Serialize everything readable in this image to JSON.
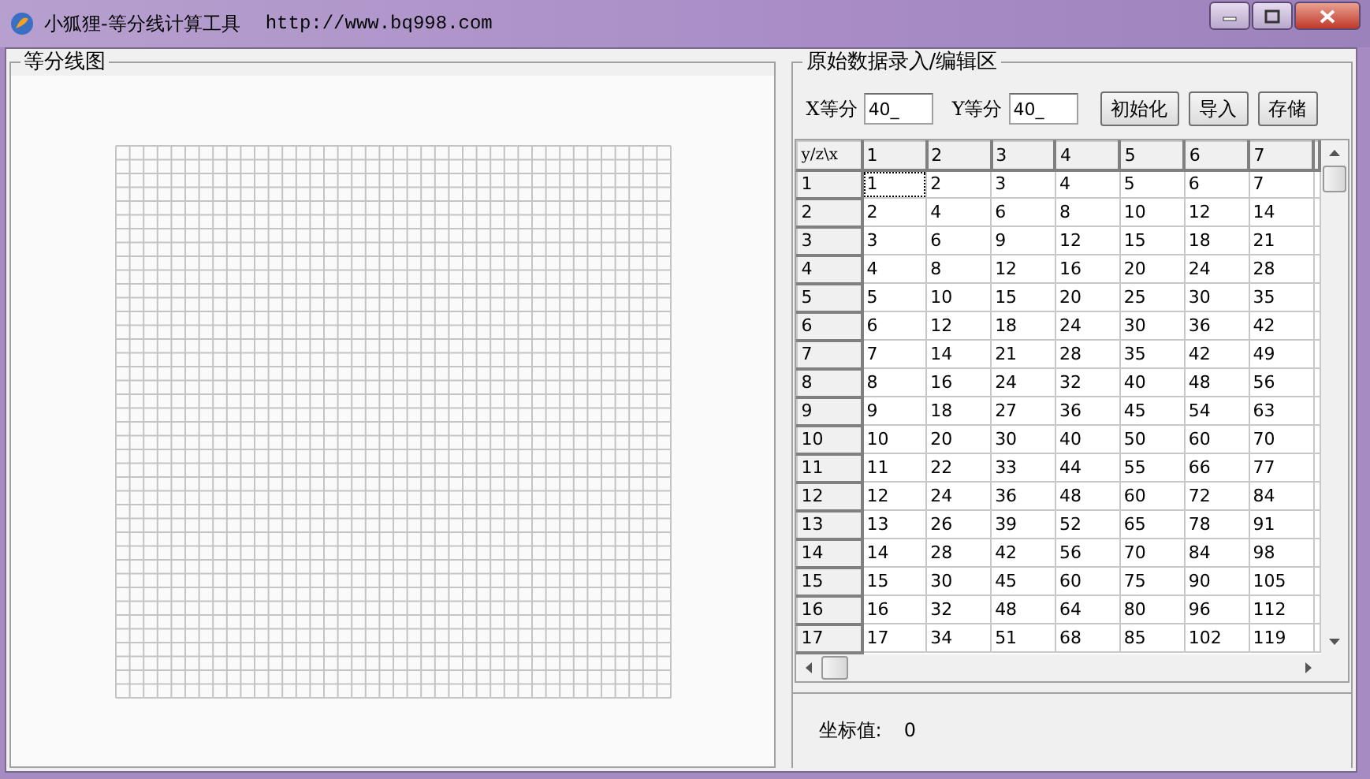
{
  "window": {
    "title": "小狐狸-等分线计算工具",
    "url": "http://www.bq998.com"
  },
  "graph_panel": {
    "title": "等分线图"
  },
  "editor_panel": {
    "title": "原始数据录入/编辑区",
    "fields": [
      {
        "label": "X等分",
        "value": "40_"
      },
      {
        "label": "Y等分",
        "value": "40_"
      }
    ],
    "buttons": [
      "初始化",
      "导入",
      "存储"
    ],
    "table": {
      "corner": "y/z\\x",
      "columns": [
        "1",
        "2",
        "3",
        "4",
        "5",
        "6",
        "7"
      ],
      "rows": [
        {
          "header": "1",
          "cells": [
            {
              "text": "1",
              "selected": true
            },
            {
              "text": "2",
              "selected": false
            },
            {
              "text": "3",
              "selected": false
            },
            {
              "text": "4",
              "selected": false
            },
            {
              "text": "5",
              "selected": false
            },
            {
              "text": "6",
              "selected": false
            },
            {
              "text": "7",
              "selected": false
            }
          ]
        },
        {
          "header": "2",
          "cells": [
            {
              "text": "2",
              "selected": false
            },
            {
              "text": "4",
              "selected": false
            },
            {
              "text": "6",
              "selected": false
            },
            {
              "text": "8",
              "selected": false
            },
            {
              "text": "10",
              "selected": false
            },
            {
              "text": "12",
              "selected": false
            },
            {
              "text": "14",
              "selected": false
            }
          ]
        },
        {
          "header": "3",
          "cells": [
            {
              "text": "3",
              "selected": false
            },
            {
              "text": "6",
              "selected": false
            },
            {
              "text": "9",
              "selected": false
            },
            {
              "text": "12",
              "selected": false
            },
            {
              "text": "15",
              "selected": false
            },
            {
              "text": "18",
              "selected": false
            },
            {
              "text": "21",
              "selected": false
            }
          ]
        },
        {
          "header": "4",
          "cells": [
            {
              "text": "4",
              "selected": false
            },
            {
              "text": "8",
              "selected": false
            },
            {
              "text": "12",
              "selected": false
            },
            {
              "text": "16",
              "selected": false
            },
            {
              "text": "20",
              "selected": false
            },
            {
              "text": "24",
              "selected": false
            },
            {
              "text": "28",
              "selected": false
            }
          ]
        },
        {
          "header": "5",
          "cells": [
            {
              "text": "5",
              "selected": false
            },
            {
              "text": "10",
              "selected": false
            },
            {
              "text": "15",
              "selected": false
            },
            {
              "text": "20",
              "selected": false
            },
            {
              "text": "25",
              "selected": false
            },
            {
              "text": "30",
              "selected": false
            },
            {
              "text": "35",
              "selected": false
            }
          ]
        },
        {
          "header": "6",
          "cells": [
            {
              "text": "6",
              "selected": false
            },
            {
              "text": "12",
              "selected": false
            },
            {
              "text": "18",
              "selected": false
            },
            {
              "text": "24",
              "selected": false
            },
            {
              "text": "30",
              "selected": false
            },
            {
              "text": "36",
              "selected": false
            },
            {
              "text": "42",
              "selected": false
            }
          ]
        },
        {
          "header": "7",
          "cells": [
            {
              "text": "7",
              "selected": false
            },
            {
              "text": "14",
              "selected": false
            },
            {
              "text": "21",
              "selected": false
            },
            {
              "text": "28",
              "selected": false
            },
            {
              "text": "35",
              "selected": false
            },
            {
              "text": "42",
              "selected": false
            },
            {
              "text": "49",
              "selected": false
            }
          ]
        },
        {
          "header": "8",
          "cells": [
            {
              "text": "8",
              "selected": false
            },
            {
              "text": "16",
              "selected": false
            },
            {
              "text": "24",
              "selected": false
            },
            {
              "text": "32",
              "selected": false
            },
            {
              "text": "40",
              "selected": false
            },
            {
              "text": "48",
              "selected": false
            },
            {
              "text": "56",
              "selected": false
            }
          ]
        },
        {
          "header": "9",
          "cells": [
            {
              "text": "9",
              "selected": false
            },
            {
              "text": "18",
              "selected": false
            },
            {
              "text": "27",
              "selected": false
            },
            {
              "text": "36",
              "selected": false
            },
            {
              "text": "45",
              "selected": false
            },
            {
              "text": "54",
              "selected": false
            },
            {
              "text": "63",
              "selected": false
            }
          ]
        },
        {
          "header": "10",
          "cells": [
            {
              "text": "10",
              "selected": false
            },
            {
              "text": "20",
              "selected": false
            },
            {
              "text": "30",
              "selected": false
            },
            {
              "text": "40",
              "selected": false
            },
            {
              "text": "50",
              "selected": false
            },
            {
              "text": "60",
              "selected": false
            },
            {
              "text": "70",
              "selected": false
            }
          ]
        },
        {
          "header": "11",
          "cells": [
            {
              "text": "11",
              "selected": false
            },
            {
              "text": "22",
              "selected": false
            },
            {
              "text": "33",
              "selected": false
            },
            {
              "text": "44",
              "selected": false
            },
            {
              "text": "55",
              "selected": false
            },
            {
              "text": "66",
              "selected": false
            },
            {
              "text": "77",
              "selected": false
            }
          ]
        },
        {
          "header": "12",
          "cells": [
            {
              "text": "12",
              "selected": false
            },
            {
              "text": "24",
              "selected": false
            },
            {
              "text": "36",
              "selected": false
            },
            {
              "text": "48",
              "selected": false
            },
            {
              "text": "60",
              "selected": false
            },
            {
              "text": "72",
              "selected": false
            },
            {
              "text": "84",
              "selected": false
            }
          ]
        },
        {
          "header": "13",
          "cells": [
            {
              "text": "13",
              "selected": false
            },
            {
              "text": "26",
              "selected": false
            },
            {
              "text": "39",
              "selected": false
            },
            {
              "text": "52",
              "selected": false
            },
            {
              "text": "65",
              "selected": false
            },
            {
              "text": "78",
              "selected": false
            },
            {
              "text": "91",
              "selected": false
            }
          ]
        },
        {
          "header": "14",
          "cells": [
            {
              "text": "14",
              "selected": false
            },
            {
              "text": "28",
              "selected": false
            },
            {
              "text": "42",
              "selected": false
            },
            {
              "text": "56",
              "selected": false
            },
            {
              "text": "70",
              "selected": false
            },
            {
              "text": "84",
              "selected": false
            },
            {
              "text": "98",
              "selected": false
            }
          ]
        },
        {
          "header": "15",
          "cells": [
            {
              "text": "15",
              "selected": false
            },
            {
              "text": "30",
              "selected": false
            },
            {
              "text": "45",
              "selected": false
            },
            {
              "text": "60",
              "selected": false
            },
            {
              "text": "75",
              "selected": false
            },
            {
              "text": "90",
              "selected": false
            },
            {
              "text": "105",
              "selected": false
            }
          ]
        },
        {
          "header": "16",
          "cells": [
            {
              "text": "16",
              "selected": false
            },
            {
              "text": "32",
              "selected": false
            },
            {
              "text": "48",
              "selected": false
            },
            {
              "text": "64",
              "selected": false
            },
            {
              "text": "80",
              "selected": false
            },
            {
              "text": "96",
              "selected": false
            },
            {
              "text": "112",
              "selected": false
            }
          ]
        },
        {
          "header": "17",
          "cells": [
            {
              "text": "17",
              "selected": false
            },
            {
              "text": "34",
              "selected": false
            },
            {
              "text": "51",
              "selected": false
            },
            {
              "text": "68",
              "selected": false
            },
            {
              "text": "85",
              "selected": false
            },
            {
              "text": "102",
              "selected": false
            },
            {
              "text": "119",
              "selected": false
            }
          ]
        }
      ]
    },
    "status": {
      "label": "坐标值:",
      "value": "0"
    }
  }
}
